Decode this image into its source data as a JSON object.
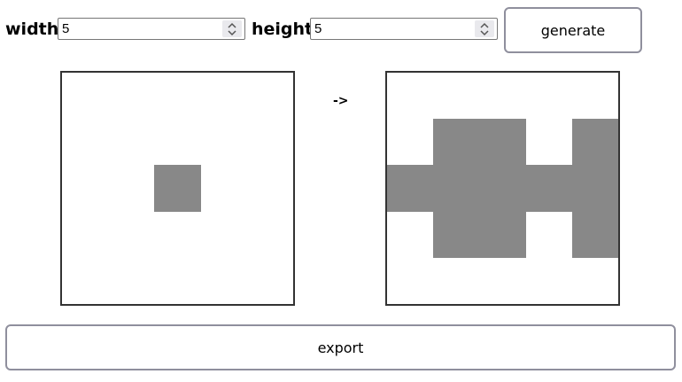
{
  "controls": {
    "width_label": "width",
    "width_value": "5",
    "height_label": "height",
    "height_value": "5",
    "generate_label": "generate",
    "export_label": "export"
  },
  "arrow_label": "->",
  "colors": {
    "filled": "#888888",
    "empty": "#ffffff",
    "border": "#333333"
  },
  "grids": {
    "rows": 5,
    "cols": 5,
    "input": [
      [
        0,
        0,
        0,
        0,
        0
      ],
      [
        0,
        0,
        0,
        0,
        0
      ],
      [
        0,
        0,
        1,
        0,
        0
      ],
      [
        0,
        0,
        0,
        0,
        0
      ],
      [
        0,
        0,
        0,
        0,
        0
      ]
    ],
    "output": [
      [
        0,
        0,
        0,
        0,
        0
      ],
      [
        0,
        1,
        1,
        0,
        1
      ],
      [
        1,
        1,
        1,
        1,
        1
      ],
      [
        0,
        1,
        1,
        0,
        1
      ],
      [
        0,
        0,
        0,
        0,
        0
      ]
    ]
  }
}
